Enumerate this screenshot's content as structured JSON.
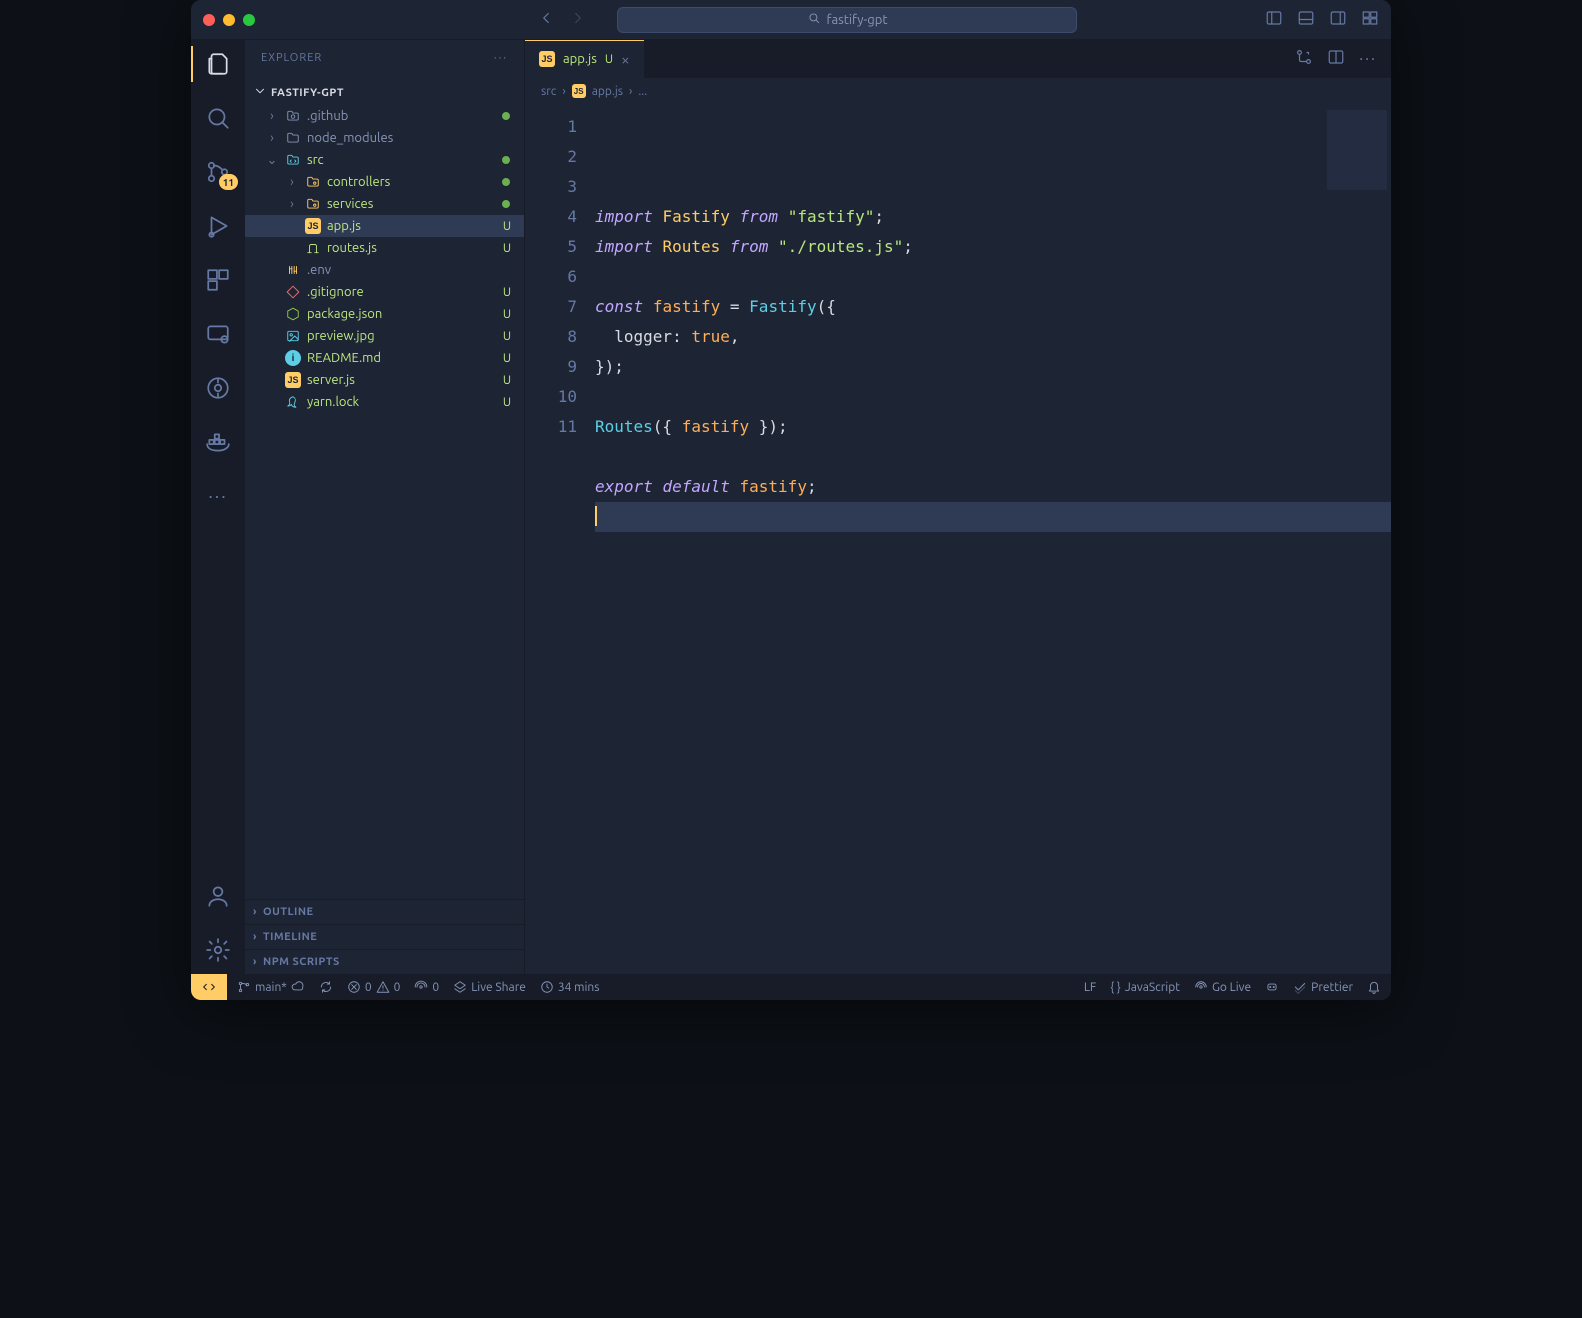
{
  "titlebar": {
    "project_name": "fastify-gpt"
  },
  "sidebar": {
    "title": "EXPLORER",
    "root_folder": "FASTIFY-GPT",
    "tree": [
      {
        "name": ".github",
        "kind": "folder",
        "depth": 1,
        "expanded": false,
        "icon": "github",
        "git": "dot"
      },
      {
        "name": "node_modules",
        "kind": "folder",
        "depth": 1,
        "expanded": false,
        "icon": "folder"
      },
      {
        "name": "src",
        "kind": "folder",
        "depth": 1,
        "expanded": true,
        "icon": "folder-src",
        "git": "dot",
        "untracked": true
      },
      {
        "name": "controllers",
        "kind": "folder",
        "depth": 2,
        "expanded": false,
        "icon": "folder-cog",
        "git": "dot",
        "untracked": true
      },
      {
        "name": "services",
        "kind": "folder",
        "depth": 2,
        "expanded": false,
        "icon": "folder-cog",
        "git": "dot",
        "untracked": true
      },
      {
        "name": "app.js",
        "kind": "file",
        "depth": 2,
        "icon": "js",
        "git": "U",
        "untracked": true,
        "active": true
      },
      {
        "name": "routes.js",
        "kind": "file",
        "depth": 2,
        "icon": "route",
        "git": "U",
        "untracked": true
      },
      {
        "name": ".env",
        "kind": "file",
        "depth": 1,
        "icon": "env"
      },
      {
        "name": ".gitignore",
        "kind": "file",
        "depth": 1,
        "icon": "git",
        "git": "U",
        "untracked": true
      },
      {
        "name": "package.json",
        "kind": "file",
        "depth": 1,
        "icon": "node",
        "git": "U",
        "untracked": true
      },
      {
        "name": "preview.jpg",
        "kind": "file",
        "depth": 1,
        "icon": "img",
        "git": "U",
        "untracked": true
      },
      {
        "name": "README.md",
        "kind": "file",
        "depth": 1,
        "icon": "md",
        "git": "U",
        "untracked": true
      },
      {
        "name": "server.js",
        "kind": "file",
        "depth": 1,
        "icon": "js",
        "git": "U",
        "untracked": true
      },
      {
        "name": "yarn.lock",
        "kind": "file",
        "depth": 1,
        "icon": "yarn",
        "git": "U",
        "untracked": true
      }
    ],
    "panels": [
      "OUTLINE",
      "TIMELINE",
      "NPM SCRIPTS"
    ]
  },
  "activitybar": {
    "scm_badge": "11"
  },
  "tabs": [
    {
      "name": "app.js",
      "icon": "js",
      "status": "U",
      "active": true
    }
  ],
  "breadcrumbs": [
    "src",
    "app.js",
    "..."
  ],
  "editor": {
    "line_count": 11,
    "lines_html": [
      "<span class='tok-kw'>import</span> <span class='tok-type'>Fastify</span> <span class='tok-kw'>from</span> <span class='tok-str'>\"fastify\"</span><span class='tok-punc'>;</span>",
      "<span class='tok-kw'>import</span> <span class='tok-type'>Routes</span> <span class='tok-kw'>from</span> <span class='tok-str'>\"./routes.js\"</span><span class='tok-punc'>;</span>",
      "",
      "<span class='tok-kw'>const</span> <span class='tok-const'>fastify</span> <span class='tok-punc'>=</span> <span class='tok-fn'>Fastify</span><span class='tok-punc'>({</span>",
      "  <span class='tok-prop'>logger</span><span class='tok-punc'>:</span> <span class='tok-const'>true</span><span class='tok-punc'>,</span>",
      "<span class='tok-punc'>});</span>",
      "",
      "<span class='tok-fn'>Routes</span><span class='tok-punc'>({</span> <span class='tok-const'>fastify</span> <span class='tok-punc'>});</span>",
      "",
      "<span class='tok-kw'>export</span> <span class='tok-kw'>default</span> <span class='tok-const'>fastify</span><span class='tok-punc'>;</span>",
      "<span class='cursor'></span>"
    ],
    "current_line_index": 10
  },
  "statusbar": {
    "branch": "main*",
    "errors": "0",
    "warnings": "0",
    "ports": "0",
    "live_share": "Live Share",
    "wakatime": "34 mins",
    "eol": "LF",
    "language": "JavaScript",
    "go_live": "Go Live",
    "prettier": "Prettier"
  }
}
